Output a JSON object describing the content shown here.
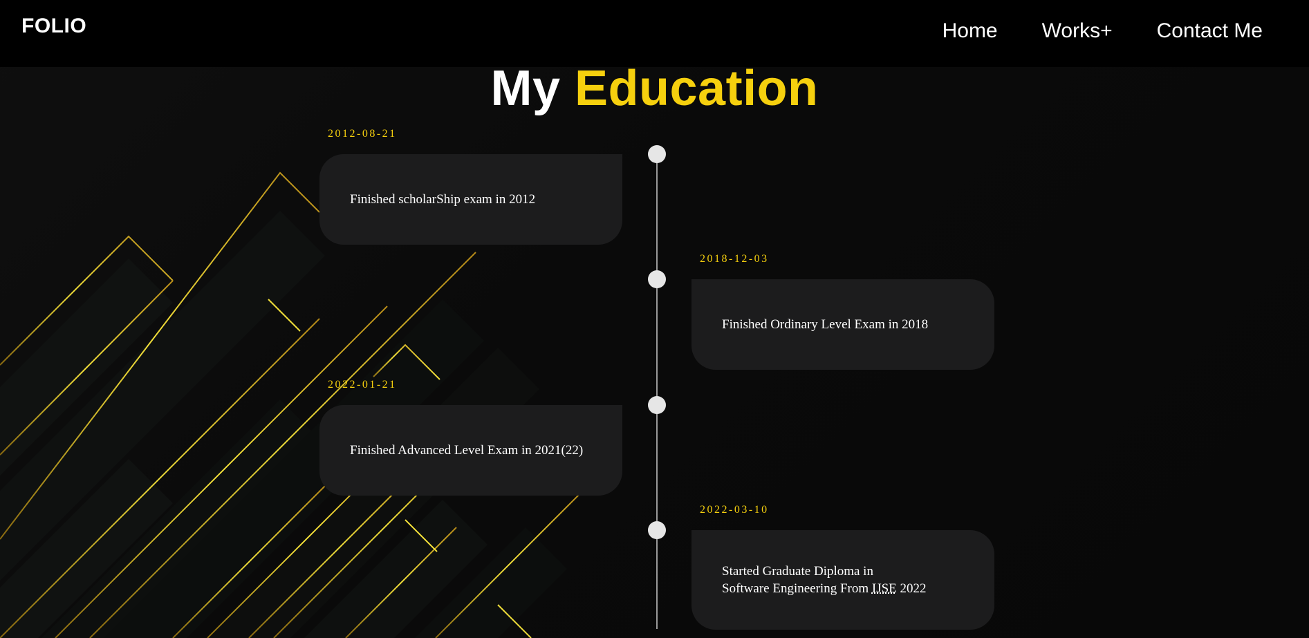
{
  "header": {
    "logo": "FOLIO",
    "nav": [
      {
        "label": "Home"
      },
      {
        "label": "Works+"
      },
      {
        "label": "Contact Me"
      }
    ]
  },
  "section": {
    "title_part1": "My",
    "title_part2": "Education"
  },
  "timeline": [
    {
      "date": "2012-08-21",
      "text": "Finished scholarShip exam in 2012"
    },
    {
      "date": "2018-12-03",
      "text": "Finished Ordinary Level Exam in 2018"
    },
    {
      "date": "2022-01-21",
      "text": "Finished Advanced Level Exam in 2021(22)"
    },
    {
      "date": "2022-03-10",
      "text_line1": "Started Graduate Diploma in",
      "text_line2_pre": "Software Engineering From ",
      "text_abbr": "IJSE",
      "text_line2_post": " 2022"
    }
  ],
  "colors": {
    "accent": "#f6d00e",
    "background": "#0a0a0a",
    "navbar": "#000000",
    "card": "#1c1c1d",
    "dot": "#e6e6e6",
    "line": "#9a9a9a"
  }
}
